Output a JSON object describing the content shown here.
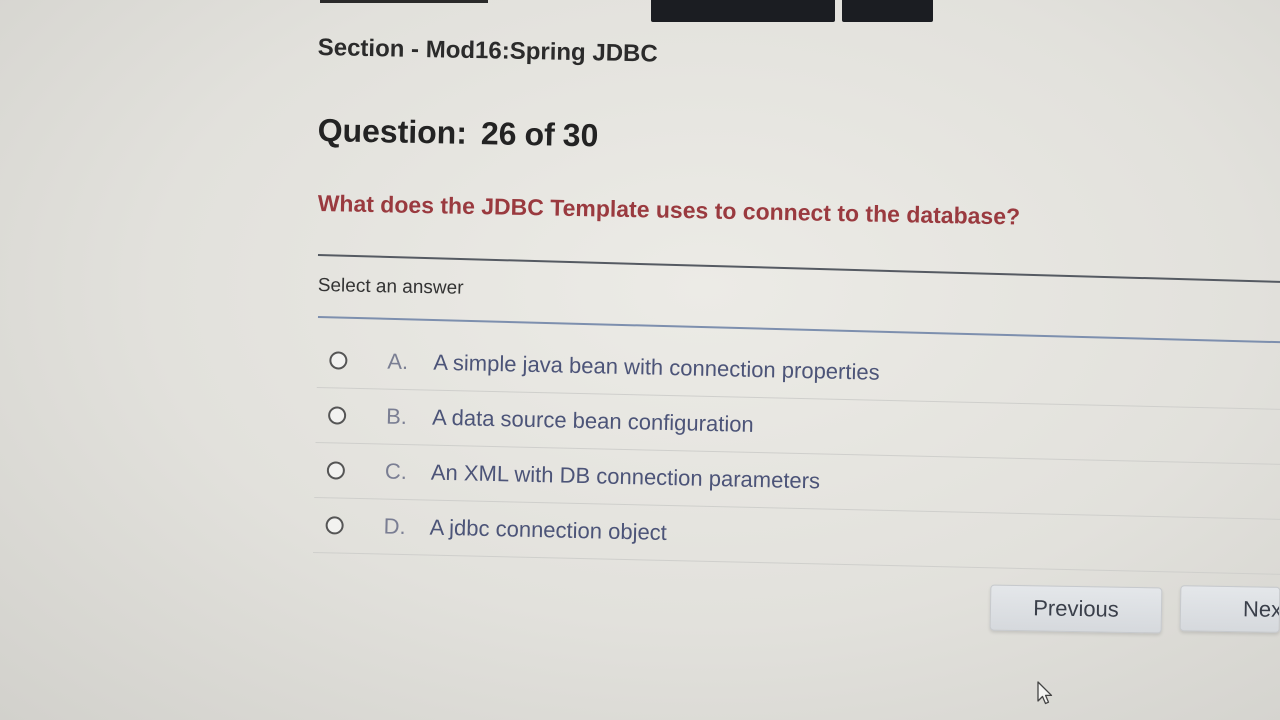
{
  "quiz": {
    "section_title": "Section - Mod16:Spring JDBC",
    "question_label": "Question:",
    "question_number": "26",
    "of_label": "of",
    "question_total": "30",
    "question_text": "What does the JDBC Template uses to connect to the database?",
    "select_prompt": "Select an answer",
    "options": [
      {
        "letter": "A.",
        "text": "A simple java bean with connection properties"
      },
      {
        "letter": "B.",
        "text": "A data source bean configuration"
      },
      {
        "letter": "C.",
        "text": "An XML with DB connection parameters"
      },
      {
        "letter": "D.",
        "text": "A jdbc connection object"
      }
    ]
  },
  "navigation": {
    "previous_label": "Previous",
    "next_label": "Nex"
  },
  "colors": {
    "question_text": "#9a3a3f",
    "option_text": "#4c5478",
    "rule_blue": "#7d8fae"
  },
  "icons": {
    "cursor": "mouse-pointer-icon",
    "radio": "radio-button-icon"
  }
}
